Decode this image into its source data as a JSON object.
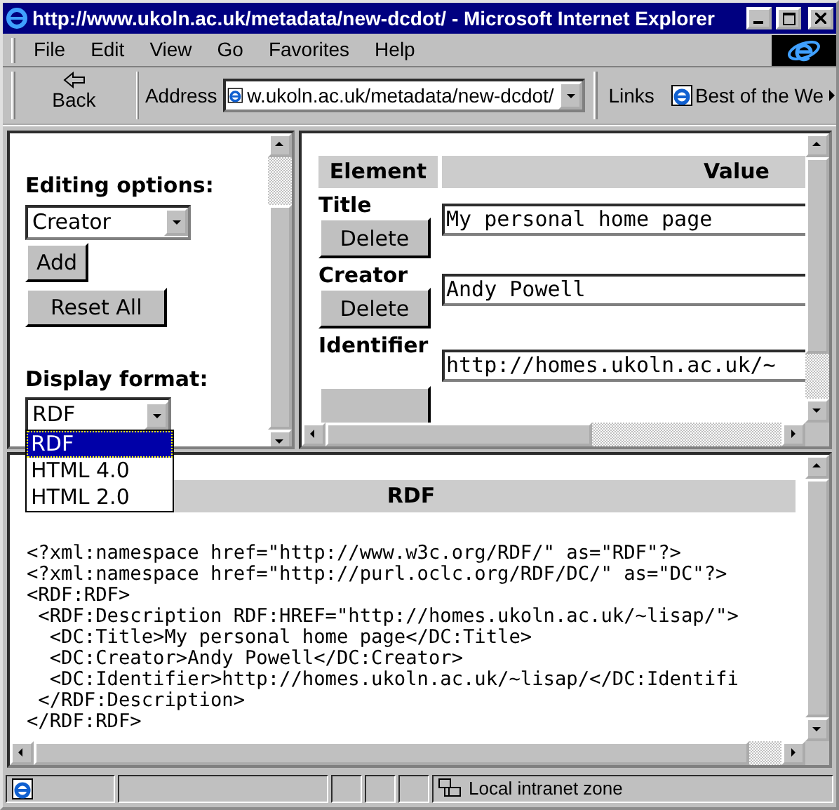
{
  "window": {
    "title": "http://www.ukoln.ac.uk/metadata/new-dcdot/ - Microsoft Internet Explorer"
  },
  "menu": [
    {
      "label": "File"
    },
    {
      "label": "Edit"
    },
    {
      "label": "View"
    },
    {
      "label": "Go"
    },
    {
      "label": "Favorites"
    },
    {
      "label": "Help"
    }
  ],
  "toolbar": {
    "back_button": "Back",
    "address_label": "Address",
    "address_value": "w.ukoln.ac.uk/metadata/new-dcdot/",
    "links_label": "Links",
    "links_item": "Best of the We"
  },
  "left_frame": {
    "editing_label": "Editing options:",
    "editing_select": "Creator",
    "buttons": [
      "Add",
      "Reset All"
    ],
    "display_label": "Display format:",
    "display_select": "RDF",
    "dropdown": {
      "expanded": true,
      "options": [
        {
          "label": "RDF",
          "selected": true
        },
        {
          "label": "HTML 4.0",
          "selected": false
        },
        {
          "label": "HTML 2.0",
          "selected": false
        }
      ]
    }
  },
  "right_frame": {
    "columns": [
      "Element",
      "Value"
    ],
    "rows": [
      {
        "element": "Title",
        "button": "Delete",
        "value": "My personal home page"
      },
      {
        "element": "Creator",
        "button": "Delete",
        "value": "Andy Powell"
      },
      {
        "element": "Identifier",
        "value": "http://homes.ukoln.ac.uk/~"
      }
    ]
  },
  "bottom_frame": {
    "heading": "RDF",
    "code": [
      "<?xml:namespace href=\"http://www.w3c.org/RDF/\" as=\"RDF\"?>",
      "<?xml:namespace href=\"http://purl.oclc.org/RDF/DC/\" as=\"DC\"?>",
      "<RDF:RDF>",
      " <RDF:Description RDF:HREF=\"http://homes.ukoln.ac.uk/~lisap/\">",
      "  <DC:Title>My personal home page</DC:Title>",
      "  <DC:Creator>Andy Powell</DC:Creator>",
      "  <DC:Identifier>http://homes.ukoln.ac.uk/~lisap/</DC:Identifi",
      " </RDF:Description>",
      "</RDF:RDF>"
    ]
  },
  "status_bar": {
    "zone": "Local intranet zone"
  }
}
